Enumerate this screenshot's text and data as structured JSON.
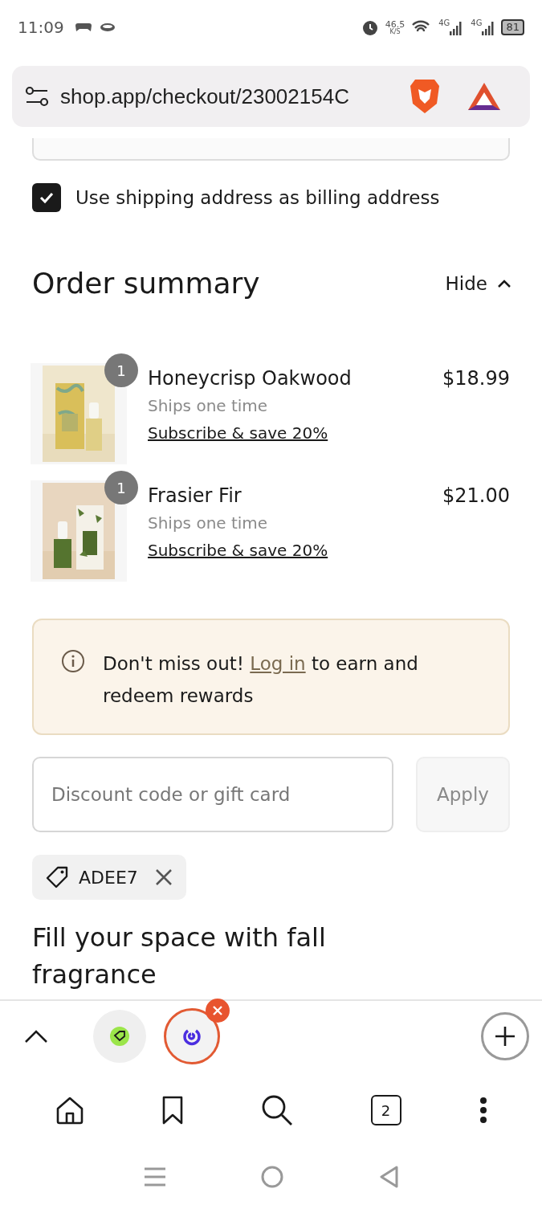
{
  "status_bar": {
    "time": "11:09",
    "speed": "46.5",
    "speed_unit": "K/S",
    "networks": [
      "4G",
      "4G"
    ],
    "battery": "81"
  },
  "address_bar": {
    "url": "shop.app/checkout/23002154C"
  },
  "billing": {
    "label": "Use shipping address as billing address",
    "checked": true
  },
  "order_summary": {
    "title": "Order summary",
    "toggle": "Hide",
    "expanded": true,
    "items": [
      {
        "name": "Honeycrisp Oakwood",
        "quantity": "1",
        "shipping": "Ships one time",
        "subscribe": "Subscribe & save 20%",
        "price": "$18.99",
        "kind": "picture"
      },
      {
        "name": "Frasier Fir",
        "quantity": "1",
        "shipping": "Ships one time",
        "subscribe": "Subscribe & save 20%",
        "price": "$21.00",
        "kind": "picture"
      }
    ]
  },
  "notice": {
    "before": "Don't miss out! ",
    "link": "Log in",
    "after": " to earn and redeem rewards"
  },
  "discount": {
    "placeholder": "Discount code or gift card",
    "button": "Apply",
    "applied_code": "ADEE7"
  },
  "section_heading": "Fill your space with fall fragrance",
  "browser_toolbar": {
    "tab_count": "2"
  }
}
